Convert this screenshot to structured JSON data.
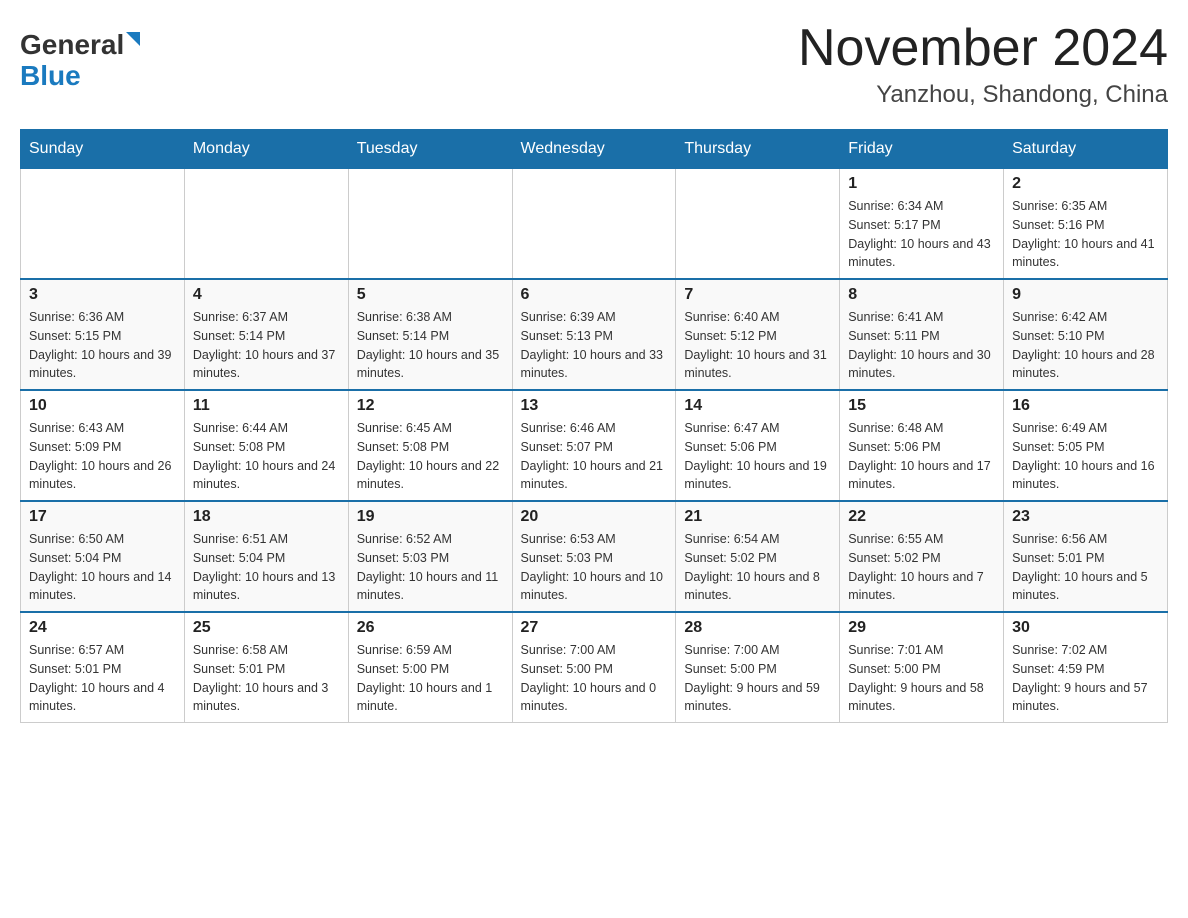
{
  "header": {
    "logo_general": "General",
    "logo_blue": "Blue",
    "title": "November 2024",
    "subtitle": "Yanzhou, Shandong, China"
  },
  "days_of_week": [
    "Sunday",
    "Monday",
    "Tuesday",
    "Wednesday",
    "Thursday",
    "Friday",
    "Saturday"
  ],
  "weeks": [
    [
      {
        "day": "",
        "info": ""
      },
      {
        "day": "",
        "info": ""
      },
      {
        "day": "",
        "info": ""
      },
      {
        "day": "",
        "info": ""
      },
      {
        "day": "",
        "info": ""
      },
      {
        "day": "1",
        "info": "Sunrise: 6:34 AM\nSunset: 5:17 PM\nDaylight: 10 hours and 43 minutes."
      },
      {
        "day": "2",
        "info": "Sunrise: 6:35 AM\nSunset: 5:16 PM\nDaylight: 10 hours and 41 minutes."
      }
    ],
    [
      {
        "day": "3",
        "info": "Sunrise: 6:36 AM\nSunset: 5:15 PM\nDaylight: 10 hours and 39 minutes."
      },
      {
        "day": "4",
        "info": "Sunrise: 6:37 AM\nSunset: 5:14 PM\nDaylight: 10 hours and 37 minutes."
      },
      {
        "day": "5",
        "info": "Sunrise: 6:38 AM\nSunset: 5:14 PM\nDaylight: 10 hours and 35 minutes."
      },
      {
        "day": "6",
        "info": "Sunrise: 6:39 AM\nSunset: 5:13 PM\nDaylight: 10 hours and 33 minutes."
      },
      {
        "day": "7",
        "info": "Sunrise: 6:40 AM\nSunset: 5:12 PM\nDaylight: 10 hours and 31 minutes."
      },
      {
        "day": "8",
        "info": "Sunrise: 6:41 AM\nSunset: 5:11 PM\nDaylight: 10 hours and 30 minutes."
      },
      {
        "day": "9",
        "info": "Sunrise: 6:42 AM\nSunset: 5:10 PM\nDaylight: 10 hours and 28 minutes."
      }
    ],
    [
      {
        "day": "10",
        "info": "Sunrise: 6:43 AM\nSunset: 5:09 PM\nDaylight: 10 hours and 26 minutes."
      },
      {
        "day": "11",
        "info": "Sunrise: 6:44 AM\nSunset: 5:08 PM\nDaylight: 10 hours and 24 minutes."
      },
      {
        "day": "12",
        "info": "Sunrise: 6:45 AM\nSunset: 5:08 PM\nDaylight: 10 hours and 22 minutes."
      },
      {
        "day": "13",
        "info": "Sunrise: 6:46 AM\nSunset: 5:07 PM\nDaylight: 10 hours and 21 minutes."
      },
      {
        "day": "14",
        "info": "Sunrise: 6:47 AM\nSunset: 5:06 PM\nDaylight: 10 hours and 19 minutes."
      },
      {
        "day": "15",
        "info": "Sunrise: 6:48 AM\nSunset: 5:06 PM\nDaylight: 10 hours and 17 minutes."
      },
      {
        "day": "16",
        "info": "Sunrise: 6:49 AM\nSunset: 5:05 PM\nDaylight: 10 hours and 16 minutes."
      }
    ],
    [
      {
        "day": "17",
        "info": "Sunrise: 6:50 AM\nSunset: 5:04 PM\nDaylight: 10 hours and 14 minutes."
      },
      {
        "day": "18",
        "info": "Sunrise: 6:51 AM\nSunset: 5:04 PM\nDaylight: 10 hours and 13 minutes."
      },
      {
        "day": "19",
        "info": "Sunrise: 6:52 AM\nSunset: 5:03 PM\nDaylight: 10 hours and 11 minutes."
      },
      {
        "day": "20",
        "info": "Sunrise: 6:53 AM\nSunset: 5:03 PM\nDaylight: 10 hours and 10 minutes."
      },
      {
        "day": "21",
        "info": "Sunrise: 6:54 AM\nSunset: 5:02 PM\nDaylight: 10 hours and 8 minutes."
      },
      {
        "day": "22",
        "info": "Sunrise: 6:55 AM\nSunset: 5:02 PM\nDaylight: 10 hours and 7 minutes."
      },
      {
        "day": "23",
        "info": "Sunrise: 6:56 AM\nSunset: 5:01 PM\nDaylight: 10 hours and 5 minutes."
      }
    ],
    [
      {
        "day": "24",
        "info": "Sunrise: 6:57 AM\nSunset: 5:01 PM\nDaylight: 10 hours and 4 minutes."
      },
      {
        "day": "25",
        "info": "Sunrise: 6:58 AM\nSunset: 5:01 PM\nDaylight: 10 hours and 3 minutes."
      },
      {
        "day": "26",
        "info": "Sunrise: 6:59 AM\nSunset: 5:00 PM\nDaylight: 10 hours and 1 minute."
      },
      {
        "day": "27",
        "info": "Sunrise: 7:00 AM\nSunset: 5:00 PM\nDaylight: 10 hours and 0 minutes."
      },
      {
        "day": "28",
        "info": "Sunrise: 7:00 AM\nSunset: 5:00 PM\nDaylight: 9 hours and 59 minutes."
      },
      {
        "day": "29",
        "info": "Sunrise: 7:01 AM\nSunset: 5:00 PM\nDaylight: 9 hours and 58 minutes."
      },
      {
        "day": "30",
        "info": "Sunrise: 7:02 AM\nSunset: 4:59 PM\nDaylight: 9 hours and 57 minutes."
      }
    ]
  ]
}
